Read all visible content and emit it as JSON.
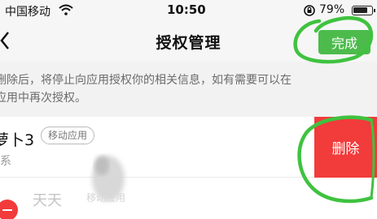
{
  "status_bar": {
    "carrier": "中国移动",
    "time": "10:50",
    "battery_percent": "79%",
    "battery_level": 0.79,
    "icons": [
      "wifi-icon",
      "rotation-lock-icon",
      "battery-icon"
    ]
  },
  "nav": {
    "back_icon": "chevron-left-icon",
    "title": "授权管理",
    "done_label": "完成"
  },
  "info": {
    "line1": "删除后，将停止向应用授权你的相关信息，如有需要可以在",
    "line2": "应用中再次授权。"
  },
  "app_row": {
    "name": "萝卜3",
    "tag": "移动应用",
    "subtitle": "系",
    "delete_label": "删除"
  },
  "next_row": {
    "name": "天天",
    "tag": "移动应用"
  },
  "colors": {
    "done_green": "#4cbb4c",
    "delete_red": "#f23b3b",
    "annotation_green": "#3fc23f"
  }
}
